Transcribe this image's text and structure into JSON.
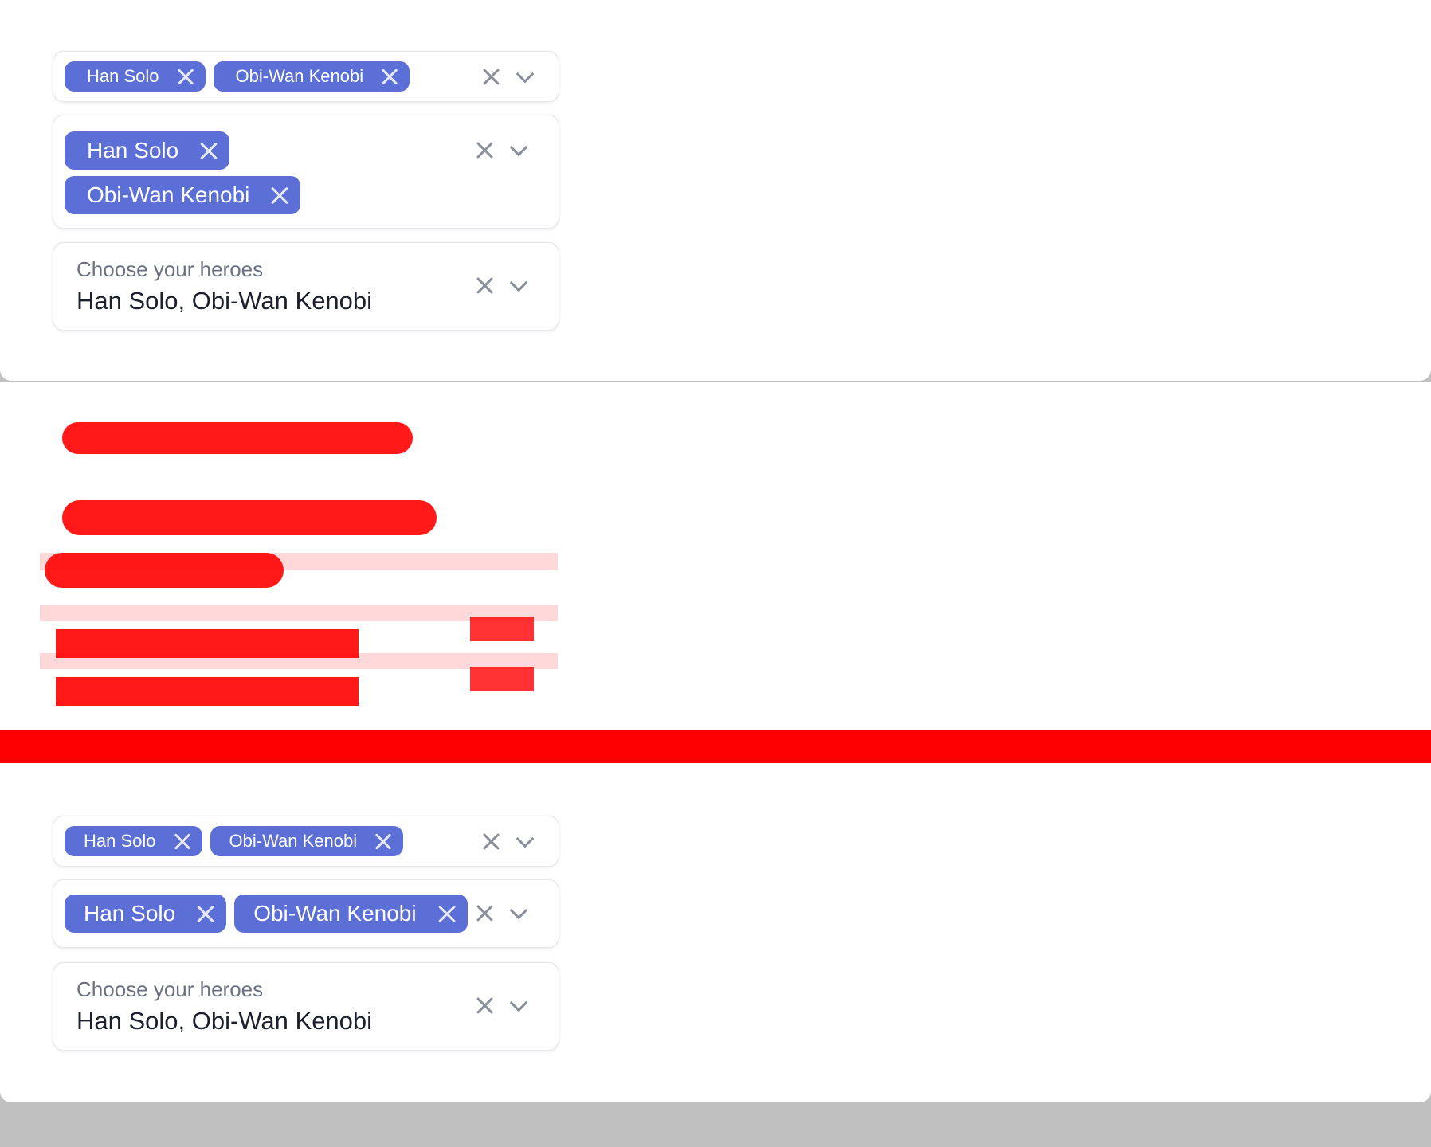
{
  "variants": [
    {
      "chips": [
        "Han Solo",
        "Obi-Wan Kenobi"
      ],
      "clear_icon": "close-icon",
      "dropdown_icon": "chevron-down-icon"
    },
    {
      "chips": [
        "Han Solo",
        "Obi-Wan Kenobi"
      ]
    },
    {
      "label": "Choose your heroes",
      "value": "Han Solo, Obi-Wan Kenobi"
    }
  ],
  "variants_bottom": [
    {
      "chips": [
        "Han Solo",
        "Obi-Wan Kenobi"
      ]
    },
    {
      "chips": [
        "Han Solo",
        "Obi-Wan Kenobi"
      ]
    },
    {
      "label": "Choose your heroes",
      "value": "Han Solo, Obi-Wan Kenobi"
    }
  ],
  "colors": {
    "chip_bg": "#5b6fd6",
    "glitch": "#ff0000",
    "backdrop": "#c0c0c0"
  }
}
